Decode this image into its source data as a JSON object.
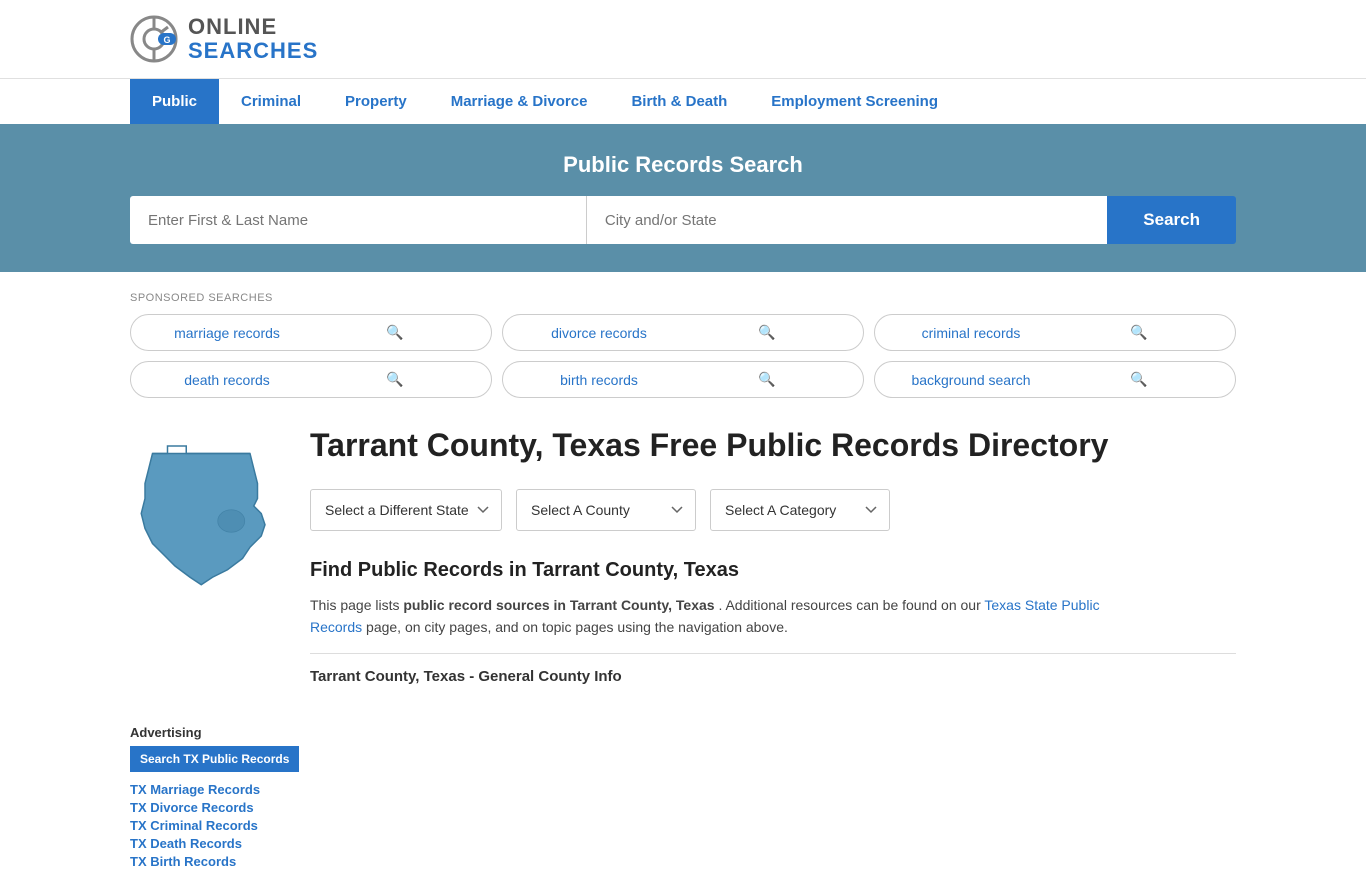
{
  "header": {
    "logo_online": "ONLINE",
    "logo_searches": "SEARCHES"
  },
  "nav": {
    "items": [
      {
        "label": "Public",
        "active": true
      },
      {
        "label": "Criminal",
        "active": false
      },
      {
        "label": "Property",
        "active": false
      },
      {
        "label": "Marriage & Divorce",
        "active": false
      },
      {
        "label": "Birth & Death",
        "active": false
      },
      {
        "label": "Employment Screening",
        "active": false
      }
    ]
  },
  "search_banner": {
    "title": "Public Records Search",
    "name_placeholder": "Enter First & Last Name",
    "location_placeholder": "City and/or State",
    "search_label": "Search"
  },
  "sponsored": {
    "label": "SPONSORED SEARCHES",
    "items": [
      "marriage records",
      "divorce records",
      "criminal records",
      "death records",
      "birth records",
      "background search"
    ]
  },
  "state_section": {
    "title": "Tarrant County, Texas Free Public Records Directory",
    "dropdown_state": "Select a Different State",
    "dropdown_county": "Select A County",
    "dropdown_category": "Select A Category",
    "find_title": "Find Public Records in Tarrant County, Texas",
    "find_description_pre": "This page lists ",
    "find_description_bold": "public record sources in Tarrant County, Texas",
    "find_description_mid": ". Additional resources can be found on our ",
    "find_link_text": "Texas State Public Records",
    "find_description_post": " page, on city pages, and on topic pages using the navigation above.",
    "county_info_heading": "Tarrant County, Texas - General County Info"
  },
  "sidebar": {
    "advertising_label": "Advertising",
    "ad_button": "Search TX Public Records",
    "links": [
      "TX Marriage Records",
      "TX Divorce Records",
      "TX Criminal Records",
      "TX Death Records",
      "TX Birth Records"
    ]
  }
}
